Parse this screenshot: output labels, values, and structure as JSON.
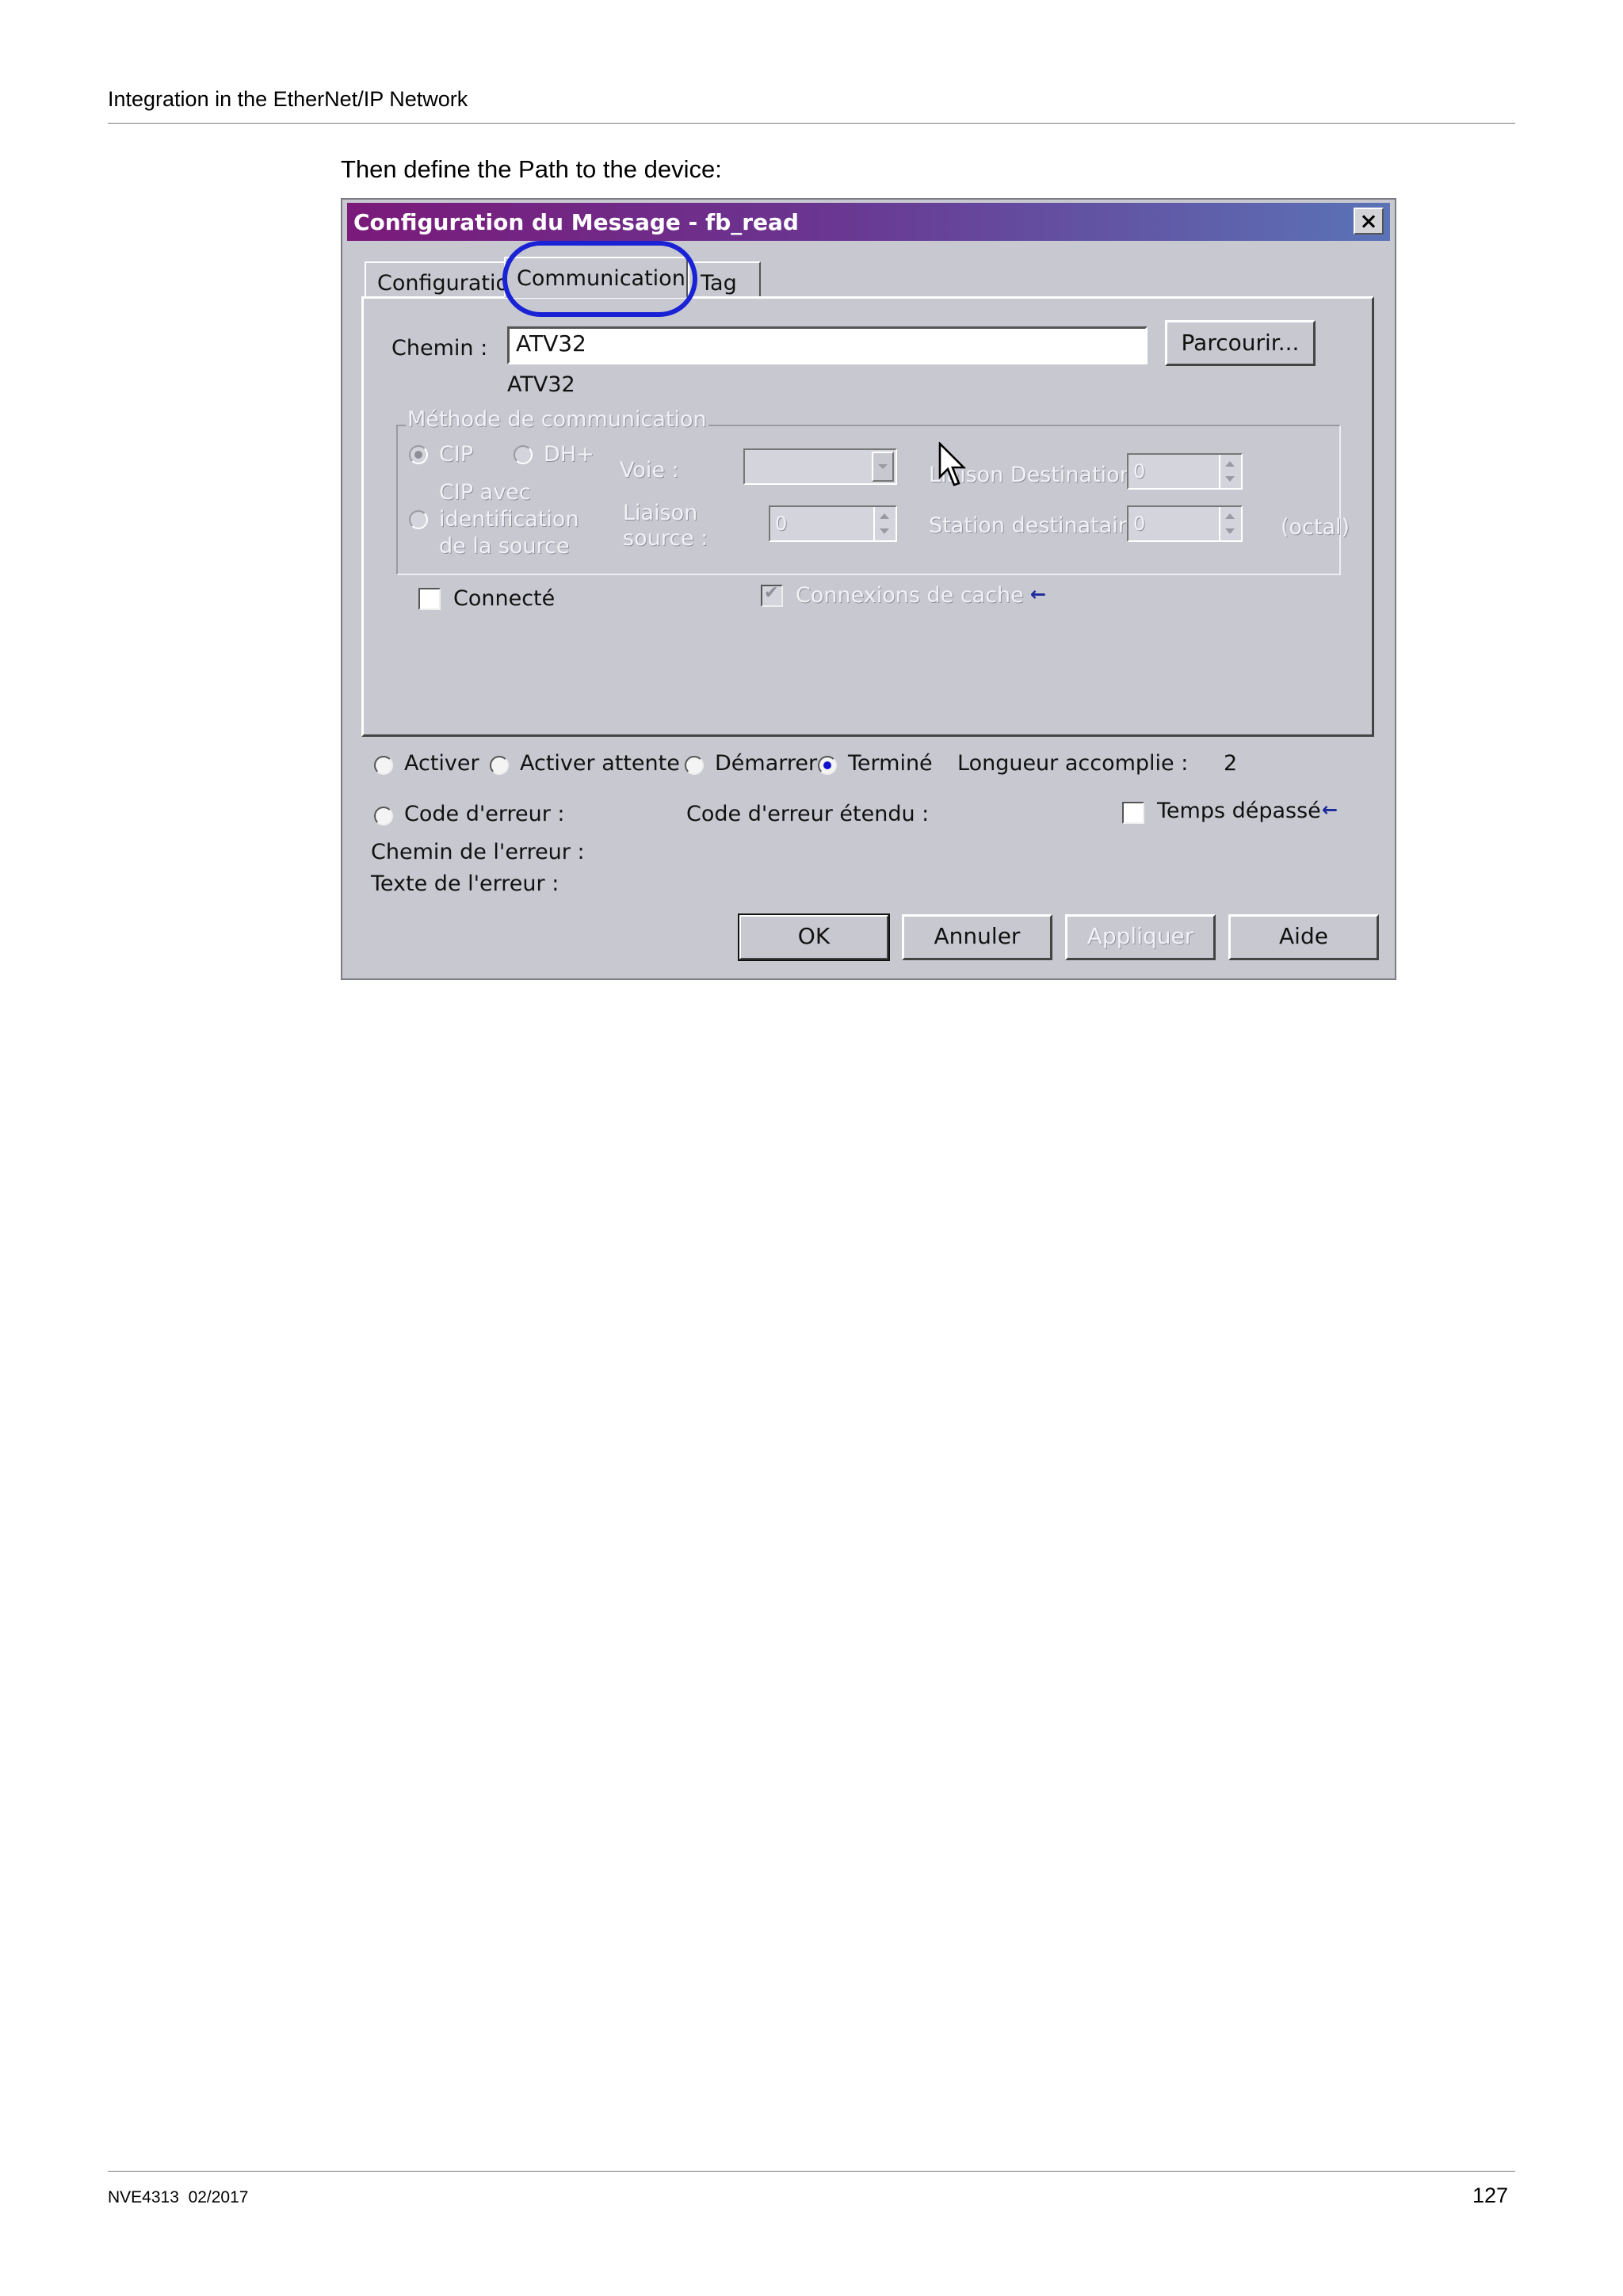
{
  "header": {
    "section_title": "Integration in the EtherNet/IP Network"
  },
  "intro_text": "Then define the Path to the device:",
  "dialog": {
    "title": "Configuration du Message - fb_read",
    "tabs": [
      "Configuration",
      "Communication",
      "Tag"
    ],
    "active_tab": "Communication",
    "path_label": "Chemin :",
    "path_value": "ATV32",
    "path_resolved": "ATV32",
    "browse_button": "Parcourir...",
    "method_group": {
      "label": "Méthode de communication",
      "cip": "CIP",
      "dhplus": "DH+",
      "cip_source_lines": [
        "CIP avec",
        "identification",
        "de la source"
      ],
      "voie_label": "Voie :",
      "liaison_source_lines": [
        "Liaison",
        "source :"
      ],
      "liaison_source_value": "0",
      "liaison_destination_label": "Liaison Destination :",
      "liaison_destination_value": "0",
      "station_destinataire_label": "Station destinataire :",
      "station_destinataire_value": "0",
      "octal_label": "(octal)"
    },
    "connected_label": "Connecté",
    "cache_label": "Connexions de cache",
    "status": {
      "activer": "Activer",
      "activer_attente": "Activer attente",
      "demarrer": "Démarrer",
      "termine": "Terminé",
      "longueur_label": "Longueur accomplie :",
      "longueur_value": "2",
      "code_erreur": "Code d'erreur :",
      "code_erreur_etendu": "Code d'erreur étendu :",
      "temps_depasse": "Temps dépassé",
      "chemin_erreur": "Chemin de l'erreur :",
      "texte_erreur": "Texte de l'erreur :"
    },
    "buttons": {
      "ok": "OK",
      "annuler": "Annuler",
      "appliquer": "Appliquer",
      "aide": "Aide"
    },
    "colors": {
      "highlight_ring": "#1a22d6",
      "title_start": "#7a1a7a",
      "title_end": "#5a73b6",
      "dialog_bg": "#c8c8d1"
    }
  },
  "footer": {
    "doc_ref": "NVE4313  02/2017",
    "page_number": "127"
  }
}
